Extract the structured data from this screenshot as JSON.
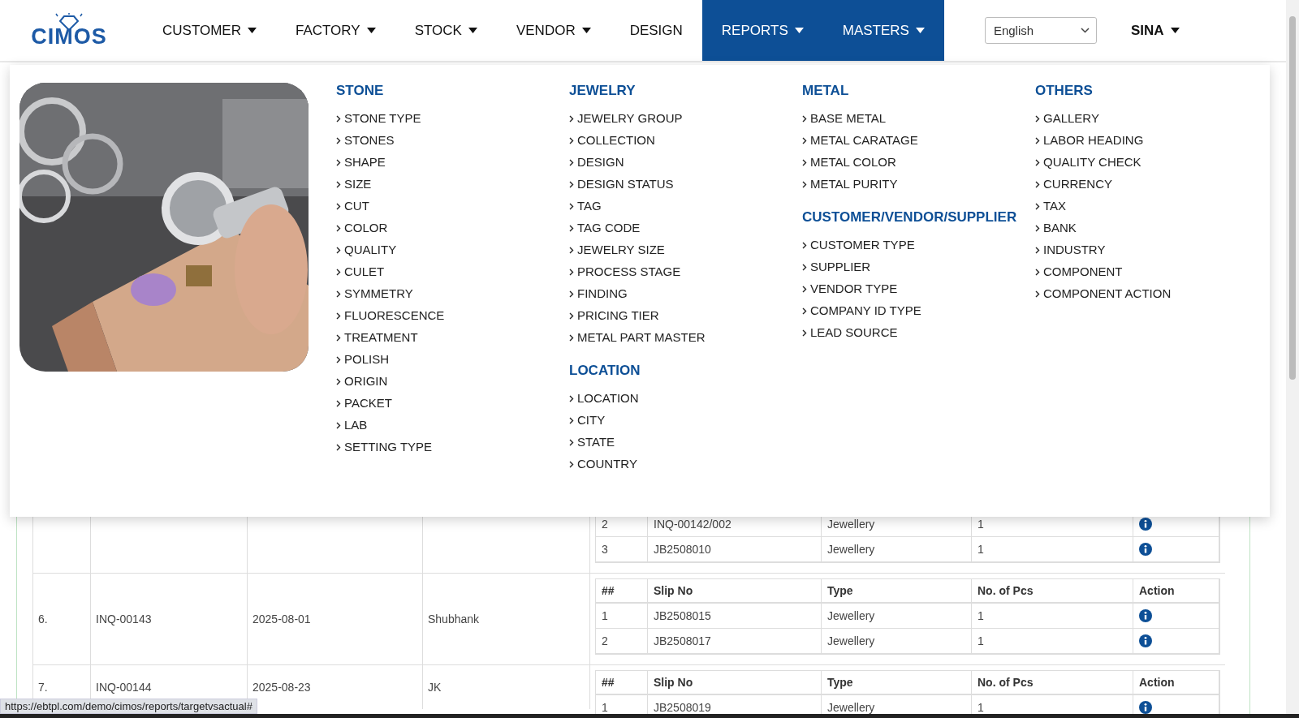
{
  "header": {
    "logo": "CIMOS",
    "nav": [
      {
        "label": "CUSTOMER",
        "dropdown": true,
        "selected": false
      },
      {
        "label": "FACTORY",
        "dropdown": true,
        "selected": false
      },
      {
        "label": "STOCK",
        "dropdown": true,
        "selected": false
      },
      {
        "label": "VENDOR",
        "dropdown": true,
        "selected": false
      },
      {
        "label": "DESIGN",
        "dropdown": false,
        "selected": false
      },
      {
        "label": "REPORTS",
        "dropdown": true,
        "selected": true
      },
      {
        "label": "MASTERS",
        "dropdown": true,
        "selected": true
      }
    ],
    "language": "English",
    "user": "SINA"
  },
  "mega_menu": {
    "columns": [
      {
        "sections": [
          {
            "title": "STONE",
            "items": [
              "STONE TYPE",
              "STONES",
              "SHAPE",
              "SIZE",
              "CUT",
              "COLOR",
              "QUALITY",
              "CULET",
              "SYMMETRY",
              "FLUORESCENCE",
              "TREATMENT",
              "POLISH",
              "ORIGIN",
              "PACKET",
              "LAB",
              "SETTING TYPE"
            ]
          }
        ]
      },
      {
        "sections": [
          {
            "title": "JEWELRY",
            "items": [
              "JEWELRY GROUP",
              "COLLECTION",
              "DESIGN",
              "DESIGN STATUS",
              "TAG",
              "TAG CODE",
              "JEWELRY SIZE",
              "PROCESS STAGE",
              "FINDING",
              "PRICING TIER",
              "METAL PART MASTER"
            ]
          },
          {
            "title": "LOCATION",
            "items": [
              "LOCATION",
              "CITY",
              "STATE",
              "COUNTRY"
            ]
          }
        ]
      },
      {
        "sections": [
          {
            "title": "METAL",
            "items": [
              "BASE METAL",
              "METAL CARATAGE",
              "METAL COLOR",
              "METAL PURITY"
            ]
          },
          {
            "title": "CUSTOMER/VENDOR/SUPPLIER",
            "items": [
              "CUSTOMER TYPE",
              "SUPPLIER",
              "VENDOR TYPE",
              "COMPANY ID TYPE",
              "LEAD SOURCE"
            ]
          }
        ]
      },
      {
        "sections": [
          {
            "title": "OTHERS",
            "items": [
              "GALLERY",
              "LABOR HEADING",
              "QUALITY CHECK",
              "CURRENCY",
              "TAX",
              "BANK",
              "INDUSTRY",
              "COMPONENT",
              "COMPONENT ACTION"
            ]
          }
        ]
      }
    ]
  },
  "table": {
    "rows": [
      {
        "slips": {
          "rows": [
            [
              "2",
              "INQ-00142/002",
              "Jewellery",
              "1"
            ],
            [
              "3",
              "JB2508010",
              "Jewellery",
              "1"
            ]
          ]
        }
      },
      {
        "cells": [
          "6.",
          "INQ-00143",
          "2025-08-01",
          "Shubhank"
        ],
        "slips": {
          "columns": [
            "##",
            "Slip No",
            "Type",
            "No. of Pcs",
            "Action"
          ],
          "rows": [
            [
              "1",
              "JB2508015",
              "Jewellery",
              "1"
            ],
            [
              "2",
              "JB2508017",
              "Jewellery",
              "1"
            ]
          ]
        }
      },
      {
        "cells": [
          "7.",
          "INQ-00144",
          "2025-08-23",
          "JK"
        ],
        "slips": {
          "columns": [
            "##",
            "Slip No",
            "Type",
            "No. of Pcs",
            "Action"
          ],
          "rows": [
            [
              "1",
              "JB2508019",
              "Jewellery",
              "1"
            ]
          ]
        }
      }
    ]
  },
  "status_bar": {
    "url": "https://ebtpl.com/demo/cimos/reports/targetvsactual#"
  }
}
